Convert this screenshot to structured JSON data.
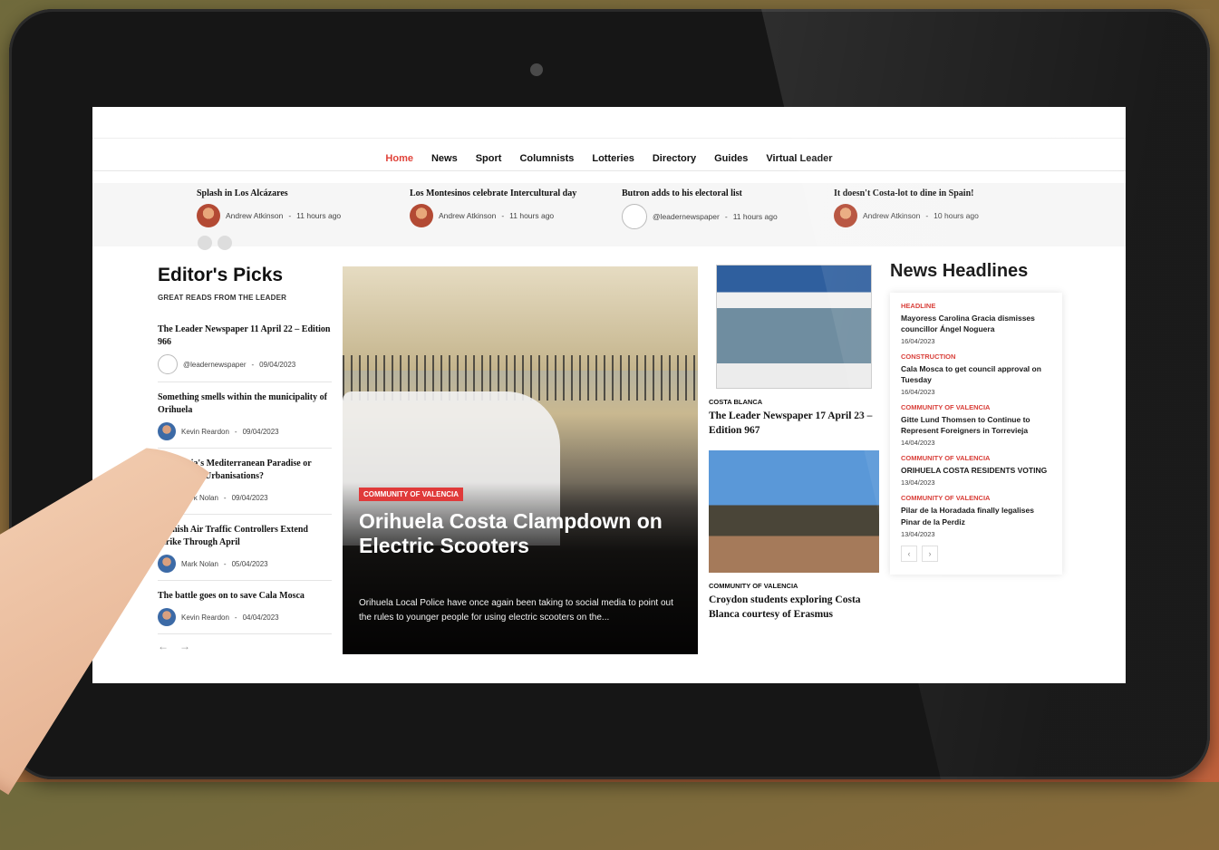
{
  "nav": [
    "Home",
    "News",
    "Sport",
    "Columnists",
    "Lotteries",
    "Directory",
    "Guides",
    "Virtual Leader"
  ],
  "ticker": [
    {
      "title": "Splash in Los Alcázares",
      "author": "Andrew Atkinson",
      "time": "11 hours ago"
    },
    {
      "title": "Los Montesinos celebrate Intercultural day",
      "author": "Andrew Atkinson",
      "time": "11 hours ago"
    },
    {
      "title": "Butron adds to his electoral list",
      "author": "@leadernewspaper",
      "time": "11 hours ago"
    },
    {
      "title": "It doesn't Costa-lot to dine in Spain!",
      "author": "Andrew Atkinson",
      "time": "10 hours ago"
    }
  ],
  "editors": {
    "title": "Editor's Picks",
    "subtitle": "GREAT READS FROM THE LEADER",
    "items": [
      {
        "title": "The Leader Newspaper 11 April 22 – Edition 966",
        "author": "@leadernewspaper",
        "date": "09/04/2023"
      },
      {
        "title": "Something smells within the municipality of Orihuela",
        "author": "Kevin Reardon",
        "date": "09/04/2023"
      },
      {
        "title": "Torrevieja's Mediterranean Paradise or Abandoned Urbanisations?",
        "author": "Mark Nolan",
        "date": "09/04/2023"
      },
      {
        "title": "Spanish Air Traffic Controllers Extend Strike Through April",
        "author": "Mark Nolan",
        "date": "05/04/2023"
      },
      {
        "title": "The battle goes on to save Cala Mosca",
        "author": "Kevin Reardon",
        "date": "04/04/2023"
      }
    ],
    "pager_prev": "←",
    "pager_next": "→"
  },
  "feature": {
    "category": "COMMUNITY OF VALENCIA",
    "headline": "Orihuela Costa Clampdown on Electric Scooters",
    "excerpt": "Orihuela Local Police have once again been taking to social media to point out the rules to younger people for using electric scooters on the..."
  },
  "middle": [
    {
      "category": "COSTA BLANCA",
      "title": "The Leader Newspaper 17 April 23 – Edition 967"
    },
    {
      "category": "COMMUNITY OF VALENCIA",
      "title": "Croydon students exploring Costa Blanca courtesy of Erasmus"
    }
  ],
  "headlines": {
    "title": "News Headlines",
    "items": [
      {
        "category": "HEADLINE",
        "title": "Mayoress Carolina Gracia dismisses councillor Ángel Noguera",
        "date": "16/04/2023"
      },
      {
        "category": "CONSTRUCTION",
        "title": "Cala Mosca to get council approval on Tuesday",
        "date": "16/04/2023"
      },
      {
        "category": "COMMUNITY OF VALENCIA",
        "title": "Gitte Lund Thomsen to Continue to Represent Foreigners in Torrevieja",
        "date": "14/04/2023"
      },
      {
        "category": "COMMUNITY OF VALENCIA",
        "title": "ORIHUELA COSTA RESIDENTS VOTING",
        "date": "13/04/2023"
      },
      {
        "category": "COMMUNITY OF VALENCIA",
        "title": "Pilar de la Horadada finally legalises Pinar de la Perdiz",
        "date": "13/04/2023"
      }
    ],
    "prev": "‹",
    "next": "›"
  }
}
